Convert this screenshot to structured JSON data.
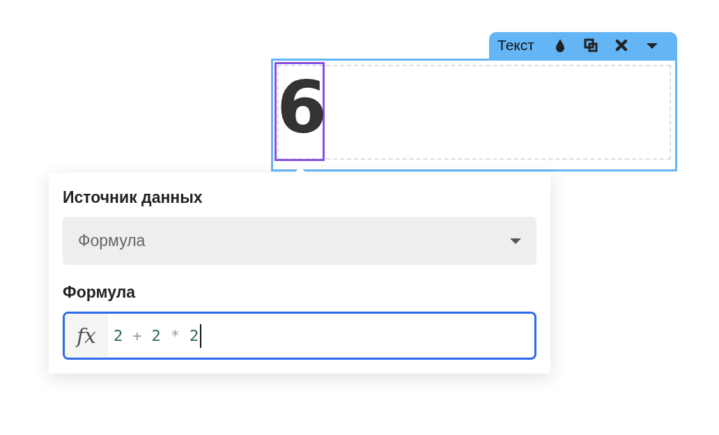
{
  "widget": {
    "label": "Текст",
    "value": "6",
    "selected": true
  },
  "settings": {
    "source_label": "Источник данных",
    "source_value": "Формула",
    "formula_label": "Формула",
    "formula_prefix": "fx",
    "formula_tokens": [
      {
        "kind": "number",
        "text": "2"
      },
      {
        "kind": "operator",
        "text": "+"
      },
      {
        "kind": "number",
        "text": "2"
      },
      {
        "kind": "operator",
        "text": "*"
      },
      {
        "kind": "number",
        "text": "2"
      }
    ],
    "formula_focused": true
  }
}
